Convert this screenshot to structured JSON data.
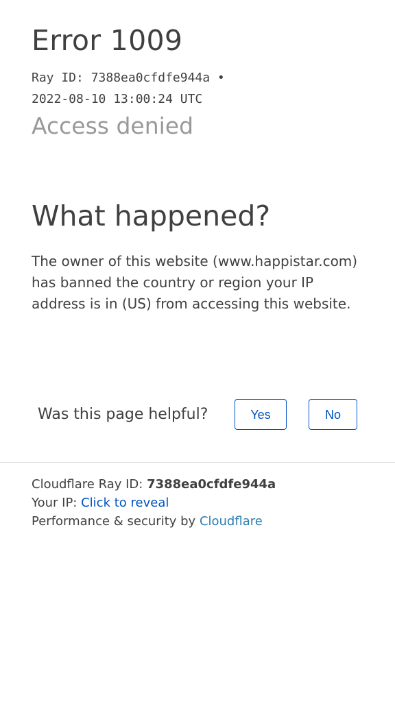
{
  "error": {
    "title": "Error 1009",
    "ray_meta": "Ray ID: 7388ea0cfdfe944a •\n2022-08-10 13:00:24 UTC",
    "subtitle": "Access denied"
  },
  "what_happened": {
    "heading": "What happened?",
    "text": "The owner of this website (www.happistar.com) has banned the country or region your IP address is in (US) from accessing this website."
  },
  "feedback": {
    "question": "Was this page helpful?",
    "yes_label": "Yes",
    "no_label": "No"
  },
  "footer": {
    "ray_label": "Cloudflare Ray ID: ",
    "ray_value": "7388ea0cfdfe944a",
    "ip_label": "Your IP: ",
    "ip_link": "Click to reveal",
    "perf_label": "Performance & security by ",
    "perf_link": "Cloudflare"
  },
  "colors": {
    "text": "#404040",
    "muted": "#999999",
    "link": "#0051c3",
    "cloudflare_link": "#2c7cb0",
    "divider": "#e0e0e0"
  }
}
